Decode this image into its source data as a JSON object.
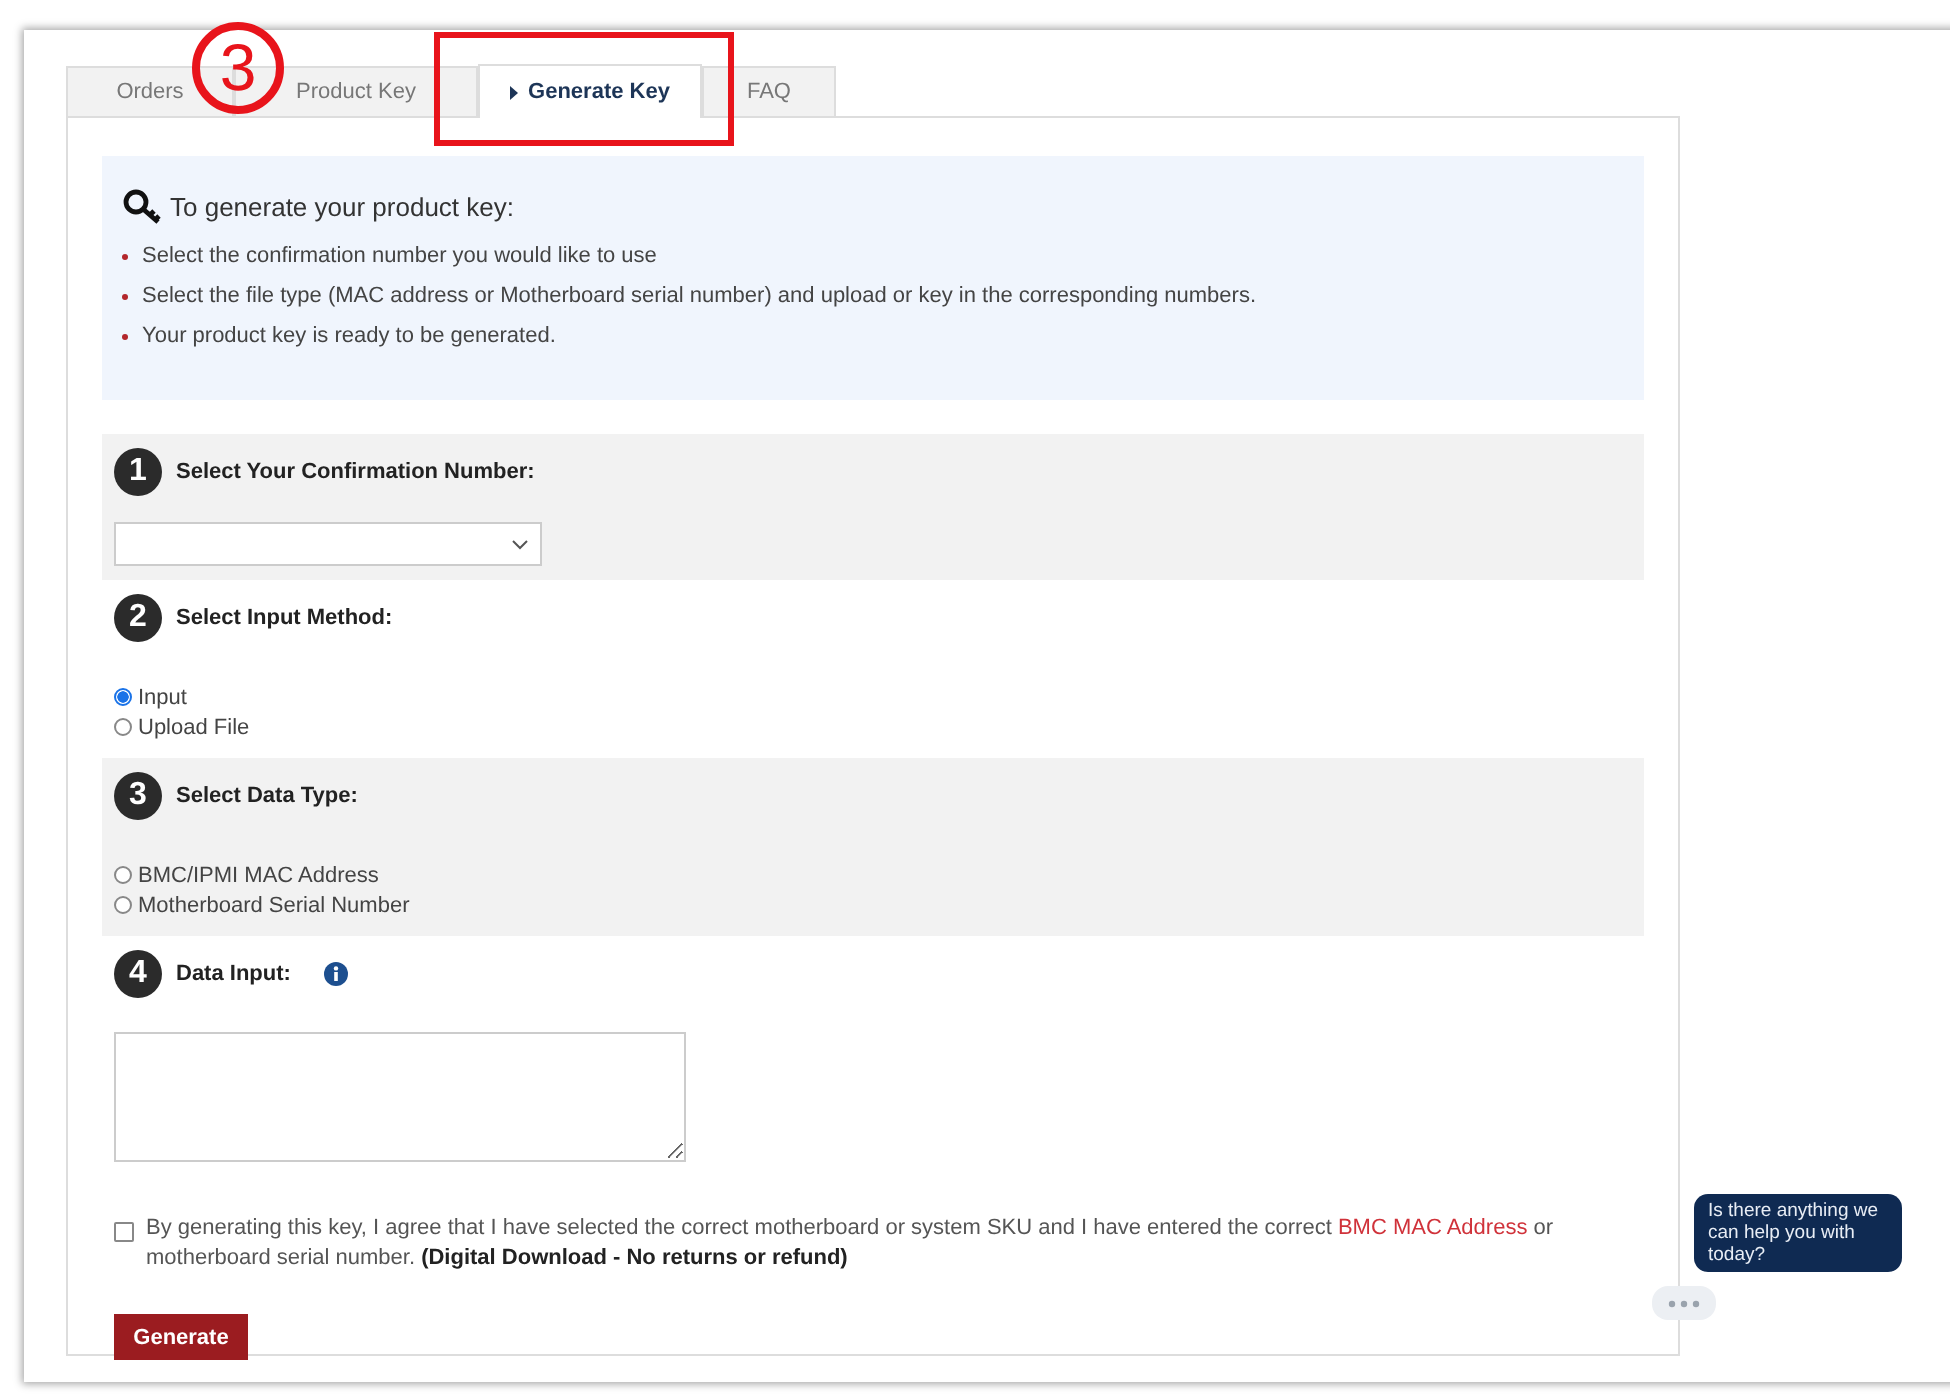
{
  "annotation": {
    "marker": "3"
  },
  "tabs": [
    {
      "label": "Orders",
      "selected": false,
      "highlighted": false
    },
    {
      "label": "Product Key",
      "selected": false,
      "highlighted": false
    },
    {
      "label": "Generate Key",
      "selected": true,
      "highlighted": true
    },
    {
      "label": "FAQ",
      "selected": false,
      "highlighted": false
    }
  ],
  "info": {
    "title": "To generate your product key:",
    "bullets": [
      "Select the confirmation number you would like to use",
      "Select the file type (MAC address or Motherboard serial number) and upload or key in the corresponding numbers.",
      "Your product key is ready to be generated."
    ]
  },
  "steps": [
    {
      "number": "1",
      "title": "Select Your Confirmation Number:",
      "shaded": true,
      "kind": "select"
    },
    {
      "number": "2",
      "title": "Select Input Method:",
      "shaded": false,
      "kind": "radios",
      "options": [
        {
          "label": "Input",
          "selected": true
        },
        {
          "label": "Upload File",
          "selected": false
        }
      ]
    },
    {
      "number": "3",
      "title": "Select Data Type:",
      "shaded": true,
      "kind": "radios",
      "options": [
        {
          "label": "BMC/IPMI MAC Address",
          "selected": false
        },
        {
          "label": "Motherboard Serial Number",
          "selected": false
        }
      ]
    },
    {
      "number": "4",
      "title": "Data Input:",
      "shaded": false,
      "kind": "textarea"
    }
  ],
  "agreement": {
    "checked": false,
    "text_before": "By generating this key, I agree that I have selected the correct motherboard or system SKU and I have entered the correct",
    "link": "BMC MAC Address",
    "text_after": "or motherboard serial number. **(Digital Download - No returns or refund)**"
  },
  "generate_button": "Generate",
  "chat": {
    "message": "Is there anything we can help you with today?"
  }
}
